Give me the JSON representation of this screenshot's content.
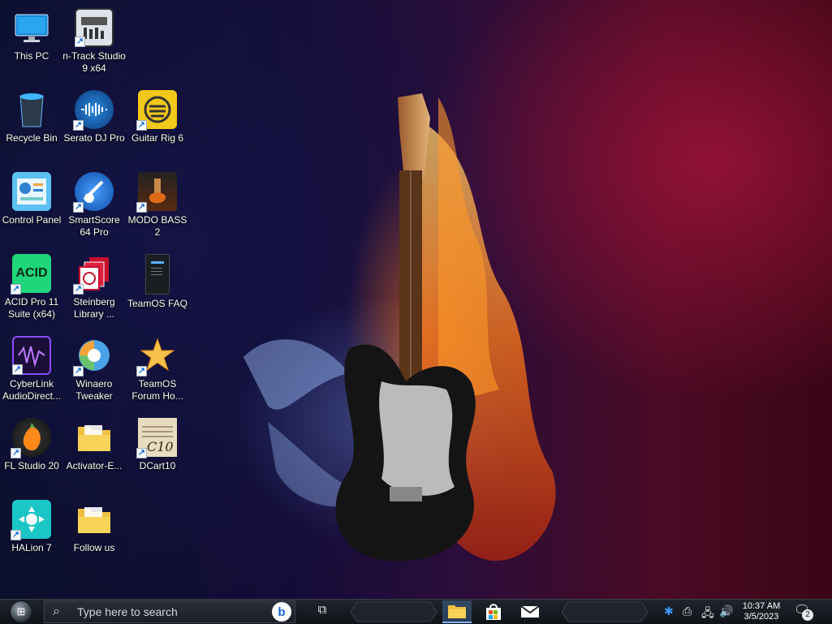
{
  "desktop": {
    "icons": [
      {
        "label": "This PC",
        "icon": "monitor-icon"
      },
      {
        "label": "n-Track Studio 9 x64",
        "icon": "ntrack-icon"
      },
      {
        "label": "Recycle Bin",
        "icon": "recycle-bin-icon"
      },
      {
        "label": "Serato DJ Pro",
        "icon": "serato-icon"
      },
      {
        "label": "Guitar Rig 6",
        "icon": "guitar-rig-icon"
      },
      {
        "label": "Control Panel",
        "icon": "control-panel-icon"
      },
      {
        "label": "SmartScore 64 Pro",
        "icon": "smartscore-icon"
      },
      {
        "label": "MODO BASS 2",
        "icon": "modo-bass-icon"
      },
      {
        "label": "ACID Pro 11 Suite (x64)",
        "icon": "acid-pro-icon"
      },
      {
        "label": "Steinberg Library ...",
        "icon": "steinberg-library-icon"
      },
      {
        "label": "TeamOS FAQ",
        "icon": "teamos-faq-icon"
      },
      {
        "label": "CyberLink AudioDirect...",
        "icon": "audiodirector-icon"
      },
      {
        "label": "Winaero Tweaker",
        "icon": "winaero-icon"
      },
      {
        "label": "TeamOS Forum Ho...",
        "icon": "teamos-forum-icon"
      },
      {
        "label": "FL Studio 20",
        "icon": "fl-studio-icon"
      },
      {
        "label": "Activator-E...",
        "icon": "folder-icon"
      },
      {
        "label": "DCart10",
        "icon": "dcart-icon"
      },
      {
        "label": "HALion 7",
        "icon": "halion-icon"
      },
      {
        "label": "Follow us",
        "icon": "folder-icon"
      }
    ]
  },
  "taskbar": {
    "search_placeholder": "Type here to search",
    "clock_time": "10:37 AM",
    "clock_date": "3/5/2023",
    "notification_count": "2"
  },
  "colors": {
    "taskbar": "#15181e",
    "accent": "#7fb3ff"
  }
}
